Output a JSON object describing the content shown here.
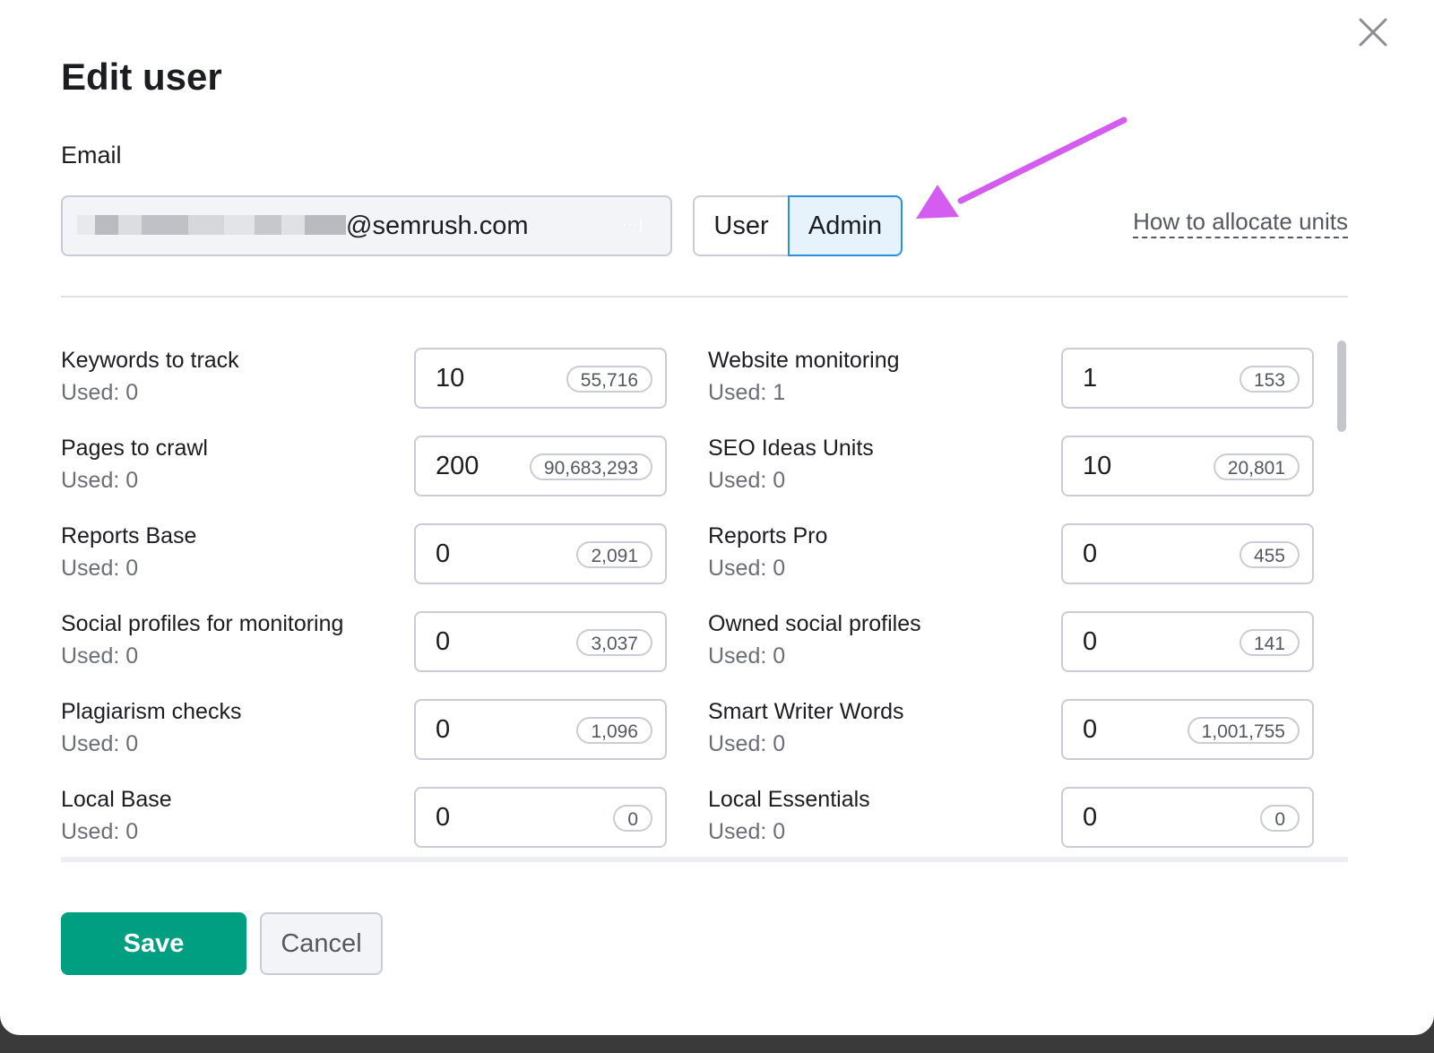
{
  "dialog": {
    "title": "Edit user",
    "close_icon": "close-icon"
  },
  "email": {
    "label": "Email",
    "visible_domain": "@semrush.com",
    "masked_dots": "···|"
  },
  "role": {
    "options": [
      "User",
      "Admin"
    ],
    "selected": "Admin"
  },
  "help_link": "How to allocate units",
  "limits": [
    {
      "name": "Keywords to track",
      "used": "Used: 0",
      "value": "10",
      "available": "55,716"
    },
    {
      "name": "Website monitoring",
      "used": "Used: 1",
      "value": "1",
      "available": "153"
    },
    {
      "name": "Pages to crawl",
      "used": "Used: 0",
      "value": "200",
      "available": "90,683,293"
    },
    {
      "name": "SEO Ideas Units",
      "used": "Used: 0",
      "value": "10",
      "available": "20,801"
    },
    {
      "name": "Reports Base",
      "used": "Used: 0",
      "value": "0",
      "available": "2,091"
    },
    {
      "name": "Reports Pro",
      "used": "Used: 0",
      "value": "0",
      "available": "455"
    },
    {
      "name": "Social profiles for monitoring",
      "used": "Used: 0",
      "value": "0",
      "available": "3,037"
    },
    {
      "name": "Owned social profiles",
      "used": "Used: 0",
      "value": "0",
      "available": "141"
    },
    {
      "name": "Plagiarism checks",
      "used": "Used: 0",
      "value": "0",
      "available": "1,096"
    },
    {
      "name": "Smart Writer Words",
      "used": "Used: 0",
      "value": "0",
      "available": "1,001,755"
    },
    {
      "name": "Local Base",
      "used": "Used: 0",
      "value": "0",
      "available": "0"
    },
    {
      "name": "Local Essentials",
      "used": "Used: 0",
      "value": "0",
      "available": "0"
    }
  ],
  "buttons": {
    "save": "Save",
    "cancel": "Cancel"
  },
  "colors": {
    "save_bg": "#009f81",
    "admin_selected_border": "#2b8fe3",
    "admin_selected_bg": "#e6f2fc",
    "annotation_arrow": "#d45cf0"
  }
}
